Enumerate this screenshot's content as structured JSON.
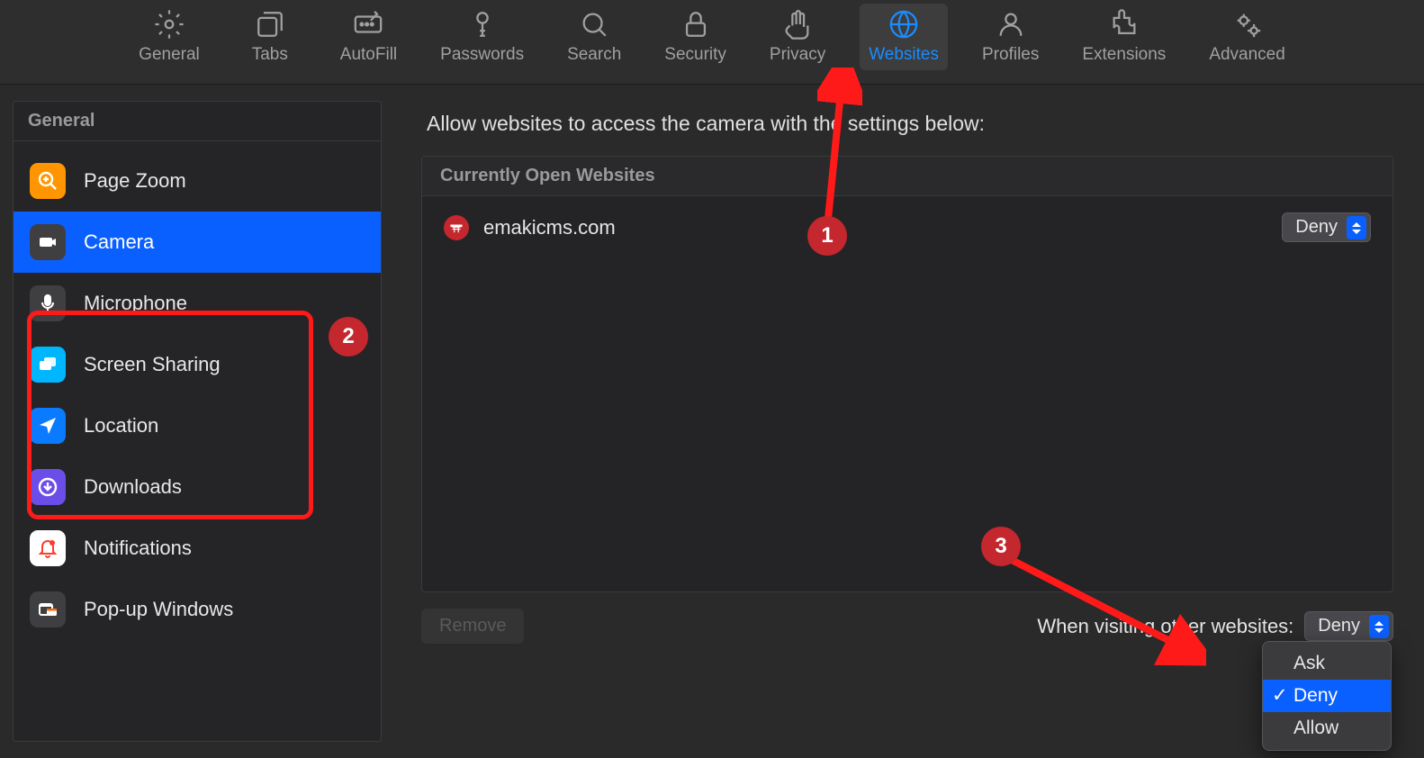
{
  "toolbar": {
    "items": [
      {
        "label": "General",
        "icon": "gear"
      },
      {
        "label": "Tabs",
        "icon": "tabs"
      },
      {
        "label": "AutoFill",
        "icon": "autofill"
      },
      {
        "label": "Passwords",
        "icon": "key"
      },
      {
        "label": "Search",
        "icon": "search"
      },
      {
        "label": "Security",
        "icon": "lock"
      },
      {
        "label": "Privacy",
        "icon": "hand"
      },
      {
        "label": "Websites",
        "icon": "globe",
        "active": true
      },
      {
        "label": "Profiles",
        "icon": "person"
      },
      {
        "label": "Extensions",
        "icon": "puzzle"
      },
      {
        "label": "Advanced",
        "icon": "gears"
      }
    ]
  },
  "sidebar": {
    "header": "General",
    "items": [
      {
        "label": "Page Zoom",
        "icon": "zoom-plus",
        "bg": "bg-orange"
      },
      {
        "label": "Camera",
        "icon": "camera",
        "bg": "bg-gray",
        "selected": true
      },
      {
        "label": "Microphone",
        "icon": "mic",
        "bg": "bg-gray"
      },
      {
        "label": "Screen Sharing",
        "icon": "screens",
        "bg": "bg-cyan"
      },
      {
        "label": "Location",
        "icon": "arrow-nav",
        "bg": "bg-blue"
      },
      {
        "label": "Downloads",
        "icon": "download",
        "bg": "bg-purple"
      },
      {
        "label": "Notifications",
        "icon": "bell",
        "bg": "bg-white"
      },
      {
        "label": "Pop-up Windows",
        "icon": "popups",
        "bg": "bg-gray"
      }
    ]
  },
  "content": {
    "title": "Allow websites to access the camera with the settings below:",
    "list_header": "Currently Open Websites",
    "sites": [
      {
        "name": "emakicms.com",
        "permission": "Deny"
      }
    ],
    "remove_label": "Remove",
    "other_label": "When visiting other websites:",
    "dropdown": {
      "options": [
        "Ask",
        "Deny",
        "Allow"
      ],
      "selected": "Deny"
    }
  },
  "annotations": {
    "badge1": "1",
    "badge2": "2",
    "badge3": "3"
  }
}
